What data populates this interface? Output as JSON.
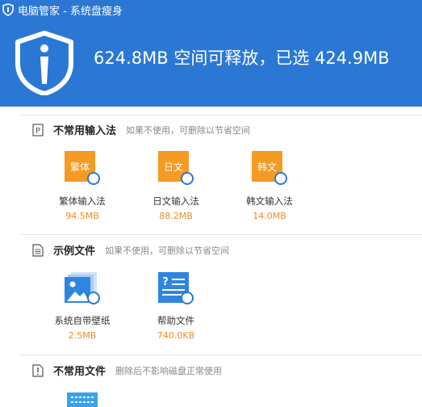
{
  "window": {
    "title": "电脑管家 - 系统盘瘦身"
  },
  "header": {
    "headline": "624.8MB 空间可释放，已选 424.9MB"
  },
  "sections": [
    {
      "title": "不常用输入法",
      "desc": "如果不使用，可删除以节省空间",
      "icon": "p-icon",
      "items": [
        {
          "name": "繁体输入法",
          "size": "94.5MB",
          "glyph": "繁体"
        },
        {
          "name": "日文输入法",
          "size": "88.2MB",
          "glyph": "日文"
        },
        {
          "name": "韩文输入法",
          "size": "14.0MB",
          "glyph": "韩文"
        }
      ]
    },
    {
      "title": "示例文件",
      "desc": "如果不使用，可删除以节省空间",
      "icon": "document-icon",
      "items": [
        {
          "name": "系统自带壁纸",
          "size": "2.5MB"
        },
        {
          "name": "帮助文件",
          "size": "740.0KB"
        }
      ]
    },
    {
      "title": "不常用文件",
      "desc": "删除后不影响磁盘正常使用",
      "icon": "file-icon",
      "items": []
    }
  ],
  "colors": {
    "brand": "#2a78d4",
    "accent": "#f59a23",
    "size_text": "#f08a24"
  }
}
